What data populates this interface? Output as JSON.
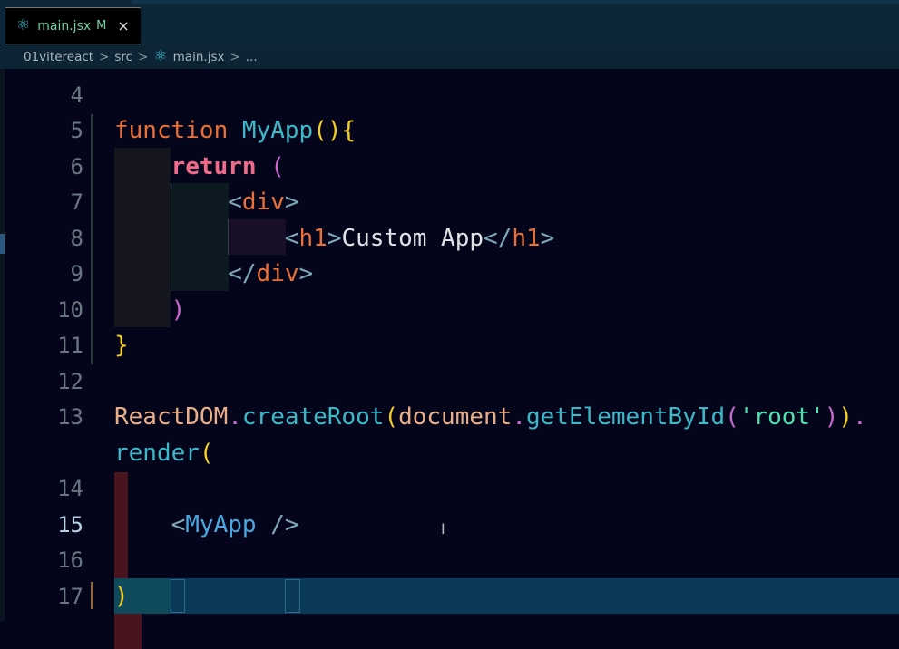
{
  "tab": {
    "icon": "react-icon",
    "filename": "main.jsx",
    "status": "M",
    "close": "×"
  },
  "breadcrumb": [
    "01vitereact",
    "src",
    "main.jsx",
    "..."
  ],
  "breadcrumb_sep": ">",
  "editor": {
    "active_line": 15,
    "rows": [
      {
        "ln": "4",
        "tokens": []
      },
      {
        "ln": "5",
        "tokens": [
          {
            "t": "function ",
            "k": "keyword"
          },
          {
            "t": "MyApp",
            "k": "fn"
          },
          {
            "t": "(){",
            "k": "brace"
          }
        ]
      },
      {
        "ln": "6",
        "tokens": [
          {
            "t": "    ",
            "k": "text"
          },
          {
            "t": "return",
            "k": "ret"
          },
          {
            "t": " (",
            "k": "paren2"
          }
        ]
      },
      {
        "ln": "7",
        "tokens": [
          {
            "t": "        ",
            "k": "text"
          },
          {
            "t": "<",
            "k": "tagp"
          },
          {
            "t": "div",
            "k": "tag"
          },
          {
            "t": ">",
            "k": "tagp"
          }
        ]
      },
      {
        "ln": "8",
        "tokens": [
          {
            "t": "            ",
            "k": "text"
          },
          {
            "t": "<",
            "k": "tagp"
          },
          {
            "t": "h1",
            "k": "tag"
          },
          {
            "t": ">",
            "k": "tagp"
          },
          {
            "t": "Custom App",
            "k": "text"
          },
          {
            "t": "</",
            "k": "tagp"
          },
          {
            "t": "h1",
            "k": "tag"
          },
          {
            "t": ">",
            "k": "tagp"
          }
        ]
      },
      {
        "ln": "9",
        "tokens": [
          {
            "t": "        ",
            "k": "text"
          },
          {
            "t": "</",
            "k": "tagp"
          },
          {
            "t": "div",
            "k": "tag"
          },
          {
            "t": ">",
            "k": "tagp"
          }
        ]
      },
      {
        "ln": "10",
        "tokens": [
          {
            "t": "    ",
            "k": "text"
          },
          {
            "t": ")",
            "k": "paren2"
          }
        ]
      },
      {
        "ln": "11",
        "tokens": [
          {
            "t": "}",
            "k": "brace"
          }
        ]
      },
      {
        "ln": "12",
        "tokens": []
      },
      {
        "ln": "13",
        "tokens": [
          {
            "t": "ReactDOM",
            "k": "obj"
          },
          {
            "t": ".",
            "k": "dot"
          },
          {
            "t": "createRoot",
            "k": "method"
          },
          {
            "t": "(",
            "k": "brace"
          },
          {
            "t": "document",
            "k": "obj"
          },
          {
            "t": ".",
            "k": "dot"
          },
          {
            "t": "getElementById",
            "k": "method"
          },
          {
            "t": "(",
            "k": "paren2"
          },
          {
            "t": "'root'",
            "k": "str"
          },
          {
            "t": ")",
            "k": "paren2"
          },
          {
            "t": ")",
            "k": "brace"
          },
          {
            "t": ".",
            "k": "dot"
          }
        ]
      },
      {
        "ln": "",
        "tokens": [
          {
            "t": "render",
            "k": "method"
          },
          {
            "t": "(",
            "k": "brace"
          }
        ]
      },
      {
        "ln": "14",
        "tokens": []
      },
      {
        "ln": "15",
        "tokens": [
          {
            "t": "    ",
            "k": "text"
          },
          {
            "t": "<",
            "k": "tagp"
          },
          {
            "t": "MyApp",
            "k": "comp"
          },
          {
            "t": " /",
            "k": "tagp"
          },
          {
            "t": ">",
            "k": "tagp"
          }
        ]
      },
      {
        "ln": "16",
        "tokens": []
      },
      {
        "ln": "17",
        "tokens": [
          {
            "t": ")",
            "k": "brace"
          }
        ]
      }
    ]
  }
}
